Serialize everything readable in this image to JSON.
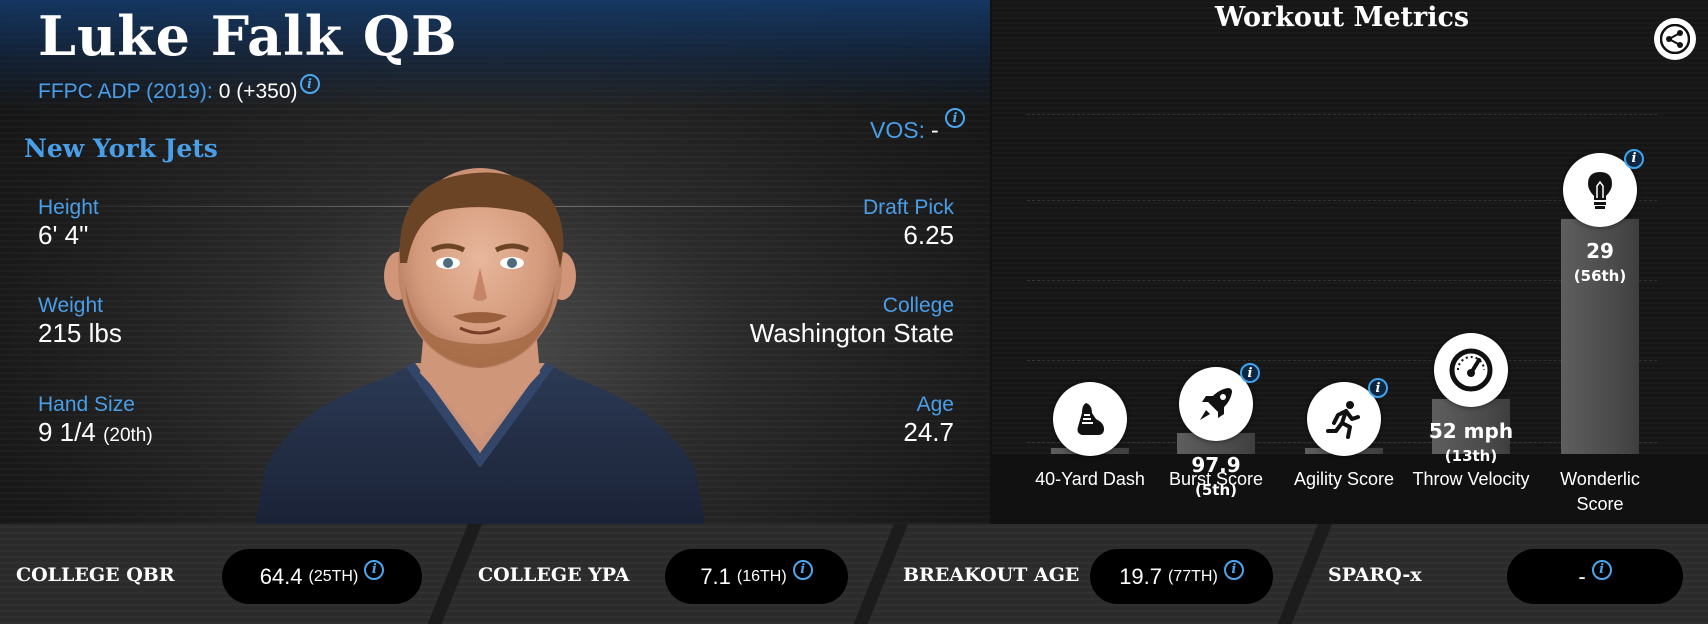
{
  "player": {
    "name": "Luke Falk QB",
    "adp_label": "FFPC ADP (2019):",
    "adp_value": "0 (+350)",
    "team": "New York Jets",
    "vos_label": "VOS:",
    "vos_value": "-",
    "info_glyph": "i"
  },
  "stats": {
    "height": {
      "label": "Height",
      "value": "6' 4\""
    },
    "weight": {
      "label": "Weight",
      "value": "215 lbs"
    },
    "hand_size": {
      "label": "Hand Size",
      "value": "9 1/4",
      "rank": "(20th)"
    },
    "draft_pick": {
      "label": "Draft Pick",
      "value": "6.25"
    },
    "college": {
      "label": "College",
      "value": "Washington State"
    },
    "age": {
      "label": "Age",
      "value": "24.7"
    }
  },
  "workout": {
    "title": "Workout Metrics",
    "share_icon": "share-icon",
    "metrics": [
      {
        "label": "40-Yard Dash",
        "value": "",
        "rank": "",
        "icon": "running-shoe-icon",
        "level": 0.0,
        "has_info": false
      },
      {
        "label": "Burst Score",
        "value": "97.9",
        "rank": "(5th)",
        "icon": "rocket-icon",
        "level": 0.05,
        "has_info": true
      },
      {
        "label": "Agility Score",
        "value": "",
        "rank": "",
        "icon": "runner-icon",
        "level": 0.0,
        "has_info": true
      },
      {
        "label": "Throw Velocity",
        "value": "52 mph",
        "rank": "(13th)",
        "icon": "speedometer-icon",
        "level": 0.13,
        "has_info": false
      },
      {
        "label": "Wonderlic Score",
        "value": "29",
        "rank": "(56th)",
        "icon": "lightbulb-icon",
        "level": 0.56,
        "has_info": true
      }
    ]
  },
  "bottom": [
    {
      "label": "COLLEGE QBR",
      "value": "64.4",
      "rank": "(25TH)"
    },
    {
      "label": "COLLEGE YPA",
      "value": "7.1",
      "rank": "(16TH)"
    },
    {
      "label": "BREAKOUT AGE",
      "value": "19.7",
      "rank": "(77TH)"
    },
    {
      "label": "SPARQ-x",
      "value": "-",
      "rank": ""
    }
  ],
  "colors": {
    "accent": "#4a9ee8",
    "info": "#4aa8f0",
    "background": "#111111"
  }
}
